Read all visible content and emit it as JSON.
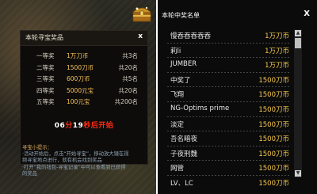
{
  "treasure": {
    "title": "本轮寻宝奖品",
    "close": "x",
    "prizes": [
      {
        "rank": "一等奖",
        "reward": "1万刀币",
        "count": "共3名"
      },
      {
        "rank": "二等奖",
        "reward": "1500刀币",
        "count": "共20名"
      },
      {
        "rank": "三等奖",
        "reward": "600刀币",
        "count": "共5名"
      },
      {
        "rank": "四等奖",
        "reward": "5000元宝",
        "count": "共20名"
      },
      {
        "rank": "五等奖",
        "reward": "100元宝",
        "count": "共200名"
      }
    ],
    "countdown": {
      "min": "06",
      "min_unit": "分",
      "sec": "19",
      "sec_unit": "秒后开始"
    },
    "tips": {
      "title": "寻宝小提示：",
      "line1": "·活动开始后，点击“开始寻宝”，移动放大镜在视",
      "line2": "  频寻宝地点进行，就有机会找到奖品",
      "line3": "·打开“我的钱包-寻宝记录”中可以查看到已获得",
      "line4": "  的奖品"
    }
  },
  "winners": {
    "title": "本轮中奖名单",
    "close": "X",
    "rows": [
      {
        "name": "慢吞吞吞吞吞",
        "reward": "1万刀币"
      },
      {
        "name": "莉li",
        "reward": "1万刀币"
      },
      {
        "name": "JUMBER",
        "reward": "1万刀币"
      },
      {
        "name": "中奖了",
        "reward": "1500刀币"
      },
      {
        "name": "飞翔",
        "reward": "1500刀币"
      },
      {
        "name": "NG-Optims prime",
        "reward": "1500刀币"
      },
      {
        "name": "淡定",
        "reward": "1500刀币"
      },
      {
        "name": "吾名暗夜",
        "reward": "1500刀币"
      },
      {
        "name": "子夜刑魏",
        "reward": "1500刀币"
      },
      {
        "name": "网管",
        "reward": "1500刀币"
      },
      {
        "name": "LV、LC",
        "reward": "1500刀币"
      }
    ]
  },
  "colors": {
    "reward_gold": "#f5c84b",
    "countdown_red": "#ff2a16"
  },
  "icons": {
    "chest": "treasure-chest-icon",
    "scroll_up": "scroll-up-icon",
    "scroll_down": "scroll-down-icon"
  }
}
